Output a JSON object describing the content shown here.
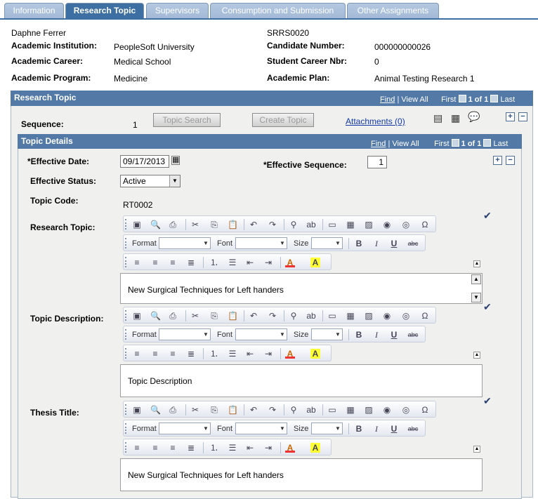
{
  "tabs": [
    "Information",
    "Research Topic",
    "Supervisors",
    "Consumption and Submission",
    "Other Assignments"
  ],
  "header": {
    "name": "Daphne Ferrer",
    "id": "SRRS0020",
    "institution_label": "Academic Institution:",
    "institution": "PeopleSoft University",
    "candidate_label": "Candidate Number:",
    "candidate": "000000000026",
    "career_label": "Academic Career:",
    "career": "Medical School",
    "career_nbr_label": "Student Career Nbr:",
    "career_nbr": "0",
    "program_label": "Academic Program:",
    "program": "Medicine",
    "plan_label": "Academic Plan:",
    "plan": "Animal Testing Research 1"
  },
  "research_box": {
    "title": "Research Topic",
    "find": "Find",
    "view_all": "View All",
    "first": "First",
    "count": "1 of 1",
    "last": "Last",
    "sequence_label": "Sequence:",
    "sequence": "1",
    "topic_search": "Topic Search",
    "create_topic": "Create Topic",
    "attachments": "Attachments (0)"
  },
  "details_box": {
    "title": "Topic Details",
    "find": "Find",
    "view_all": "View All",
    "first": "First",
    "count": "1 of 1",
    "last": "Last",
    "eff_date_label": "*Effective Date:",
    "eff_date": "09/17/2013",
    "eff_seq_label": "*Effective Sequence:",
    "eff_seq": "1",
    "eff_status_label": "Effective Status:",
    "eff_status": "Active",
    "topic_code_label": "Topic Code:",
    "topic_code": "RT0002",
    "research_topic_label": "Research Topic:",
    "research_topic_text": "New Surgical Techniques for Left handers",
    "topic_desc_label": "Topic Description:",
    "topic_desc_text": "Topic Description",
    "thesis_label": "Thesis Title:",
    "thesis_text": "New Surgical Techniques for Left handers"
  },
  "toolbar": {
    "format": "Format",
    "font": "Font",
    "size": "Size",
    "bold": "B",
    "italic": "I",
    "underline": "U",
    "strike": "abc"
  }
}
